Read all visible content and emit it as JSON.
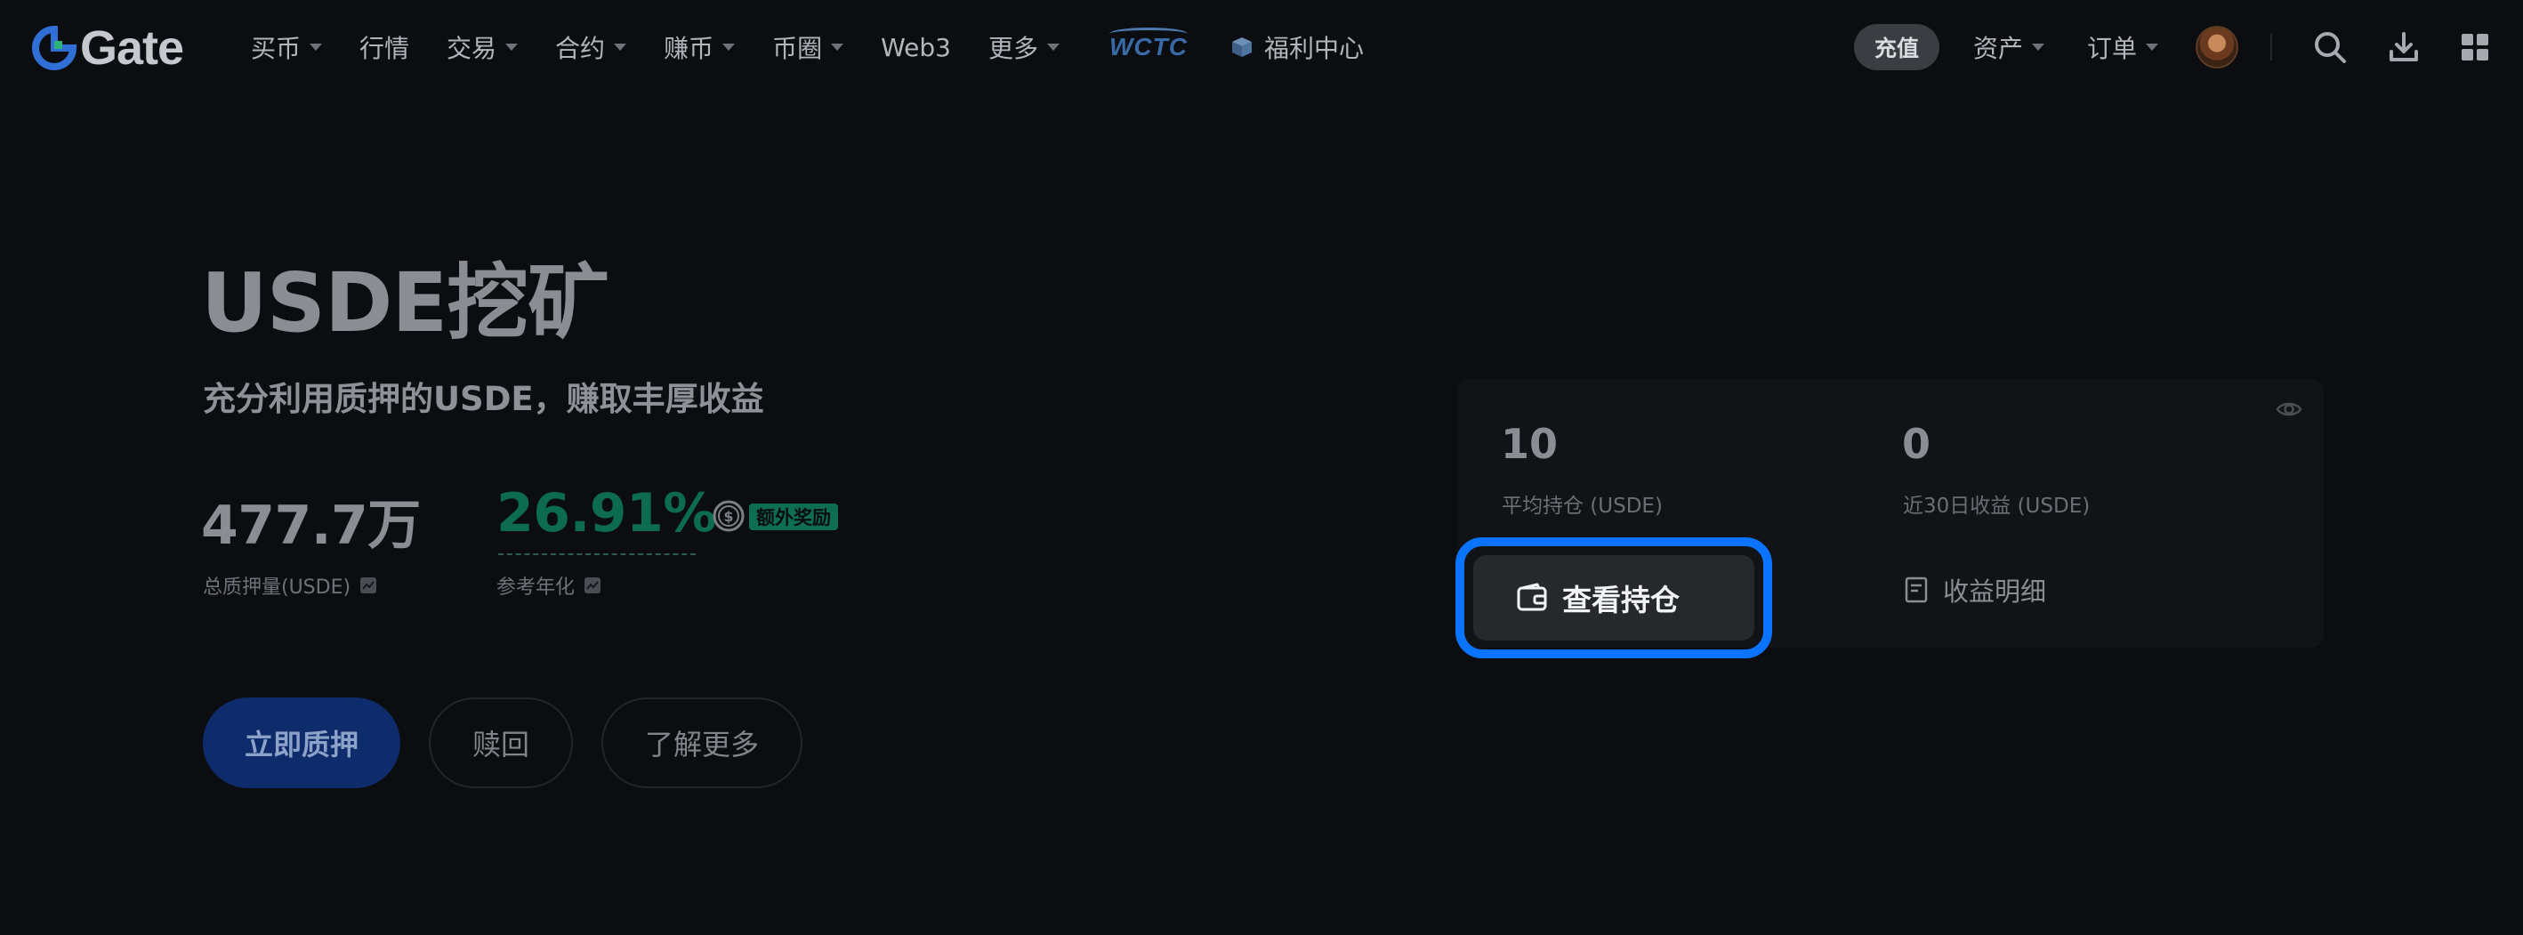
{
  "nav": {
    "logo_text": "Gate",
    "items": [
      {
        "label": "买币",
        "dropdown": true
      },
      {
        "label": "行情",
        "dropdown": false
      },
      {
        "label": "交易",
        "dropdown": true
      },
      {
        "label": "合约",
        "dropdown": true
      },
      {
        "label": "赚币",
        "dropdown": true
      },
      {
        "label": "币圈",
        "dropdown": true
      },
      {
        "label": "Web3",
        "dropdown": false
      },
      {
        "label": "更多",
        "dropdown": true
      }
    ],
    "wctc_label": "WCTC",
    "welfare_label": "福利中心",
    "deposit_label": "充值",
    "assets_label": "资产",
    "orders_label": "订单"
  },
  "hero": {
    "title": "USDE挖矿",
    "subtitle": "充分利用质押的USDE，赚取丰厚收益",
    "total_staked_value": "477.7万",
    "total_staked_label": "总质押量(USDE)",
    "apr_value": "26.91%",
    "apr_label": "参考年化",
    "bonus_badge": "额外奖励",
    "stake_button": "立即质押",
    "redeem_button": "赎回",
    "learn_more_button": "了解更多"
  },
  "card": {
    "avg_position_value": "10",
    "avg_position_label": "平均持仓 (USDE)",
    "earnings_value": "0",
    "earnings_label": "近30日收益 (USDE)",
    "view_positions_button": "查看持仓",
    "earnings_detail_link": "收益明细"
  },
  "colors": {
    "background": "#0b0d10",
    "accent_green": "#0d6b50",
    "primary_blue": "#0e2c6b",
    "highlight_blue": "#0a74ff"
  }
}
